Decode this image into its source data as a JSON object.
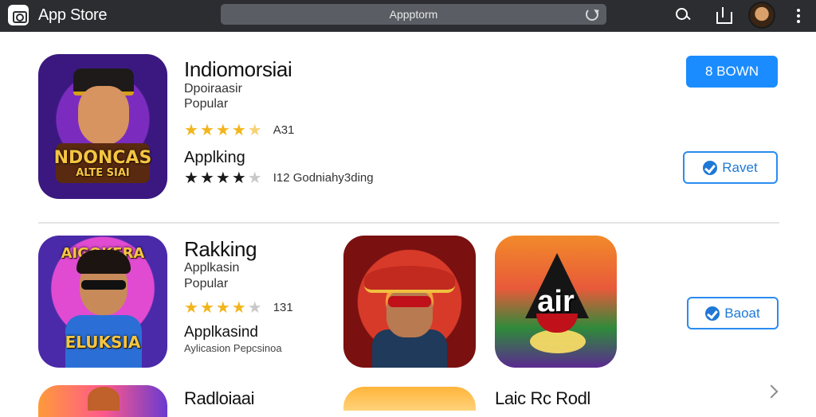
{
  "topbar": {
    "app_title": "App Store",
    "url": "Appptorm",
    "icons": [
      "app-store-icon",
      "reload-icon",
      "search-icon",
      "share-icon",
      "avatar",
      "more-icon"
    ]
  },
  "row1": {
    "title": "Indiomorsiai",
    "subtitle": "Dpoiraasir",
    "category": "Popular",
    "rating_value": 4.5,
    "rating_count": "A31",
    "icon_text": "NDONCAS",
    "icon_text2": "ALTE SIAI",
    "section_label": "Applking",
    "rating2_value": 4,
    "rating2_text": "I12 Godniahy3ding",
    "primary_button": "8 BOWN",
    "secondary_button": "Ravet"
  },
  "row2": {
    "title": "Rakking",
    "subtitle": "Applkasin",
    "category": "Popular",
    "rating_value": 4,
    "rating_count": "131",
    "icon_text_top": "AIGOKERA",
    "icon_text_bottom": "ELUKSIA",
    "section_label": "Applkasind",
    "section_sub": "Aylicasion Pepcsinoa",
    "icon4_text": "air",
    "button": "Baoat"
  },
  "row3": {
    "title": "Radloiaai",
    "title2": "Laic Rc Rodl"
  },
  "colors": {
    "topbar_bg": "#2b2d31",
    "accent": "#1a8cff",
    "star": "#f2b51c"
  }
}
